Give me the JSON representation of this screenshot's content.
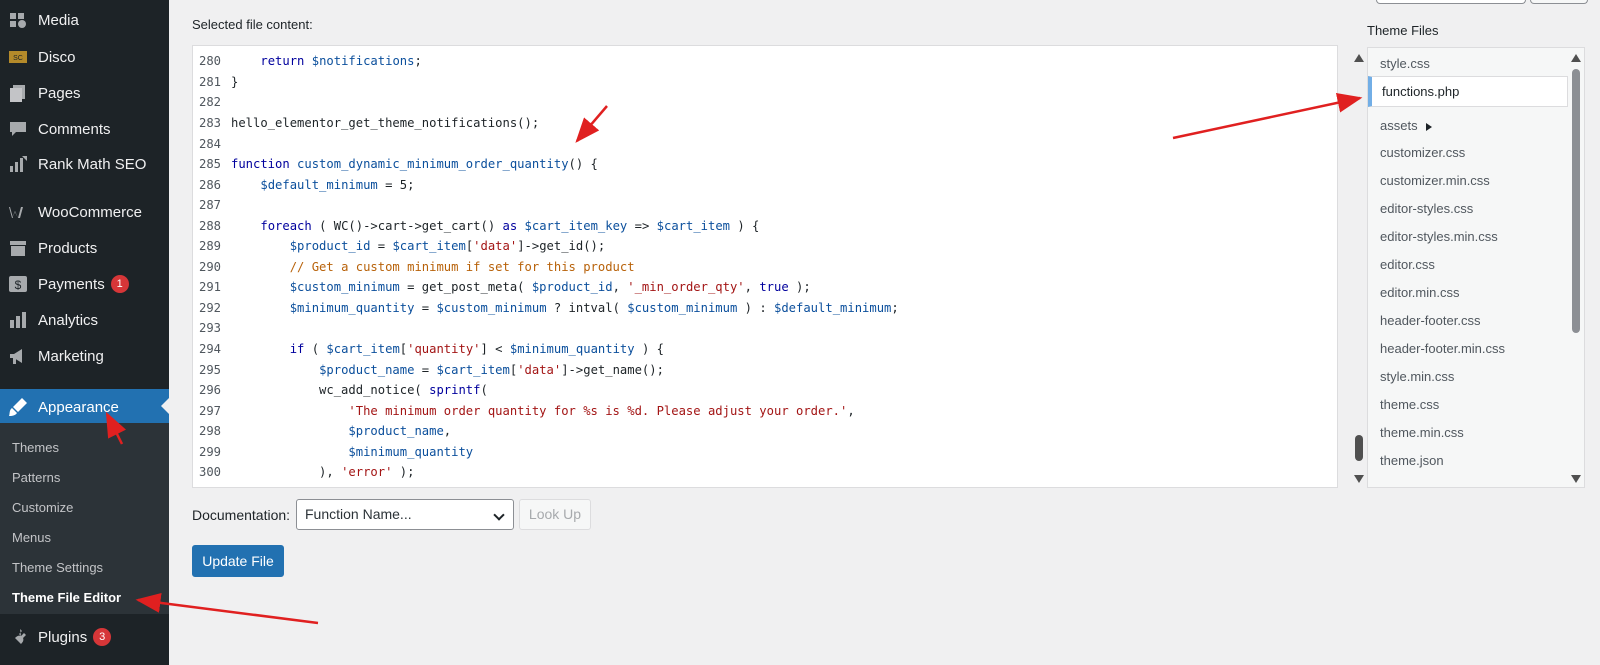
{
  "sidebar": {
    "items": [
      {
        "label": "Media",
        "icon": "media-icon"
      },
      {
        "label": "Disco",
        "icon": "disco-icon"
      },
      {
        "label": "Pages",
        "icon": "pages-icon"
      },
      {
        "label": "Comments",
        "icon": "comments-icon"
      },
      {
        "label": "Rank Math SEO",
        "icon": "rank-math-icon"
      },
      {
        "label": "WooCommerce",
        "icon": "woocommerce-icon"
      },
      {
        "label": "Products",
        "icon": "products-icon"
      },
      {
        "label": "Payments",
        "icon": "payments-icon",
        "badge": "1"
      },
      {
        "label": "Analytics",
        "icon": "analytics-icon"
      },
      {
        "label": "Marketing",
        "icon": "marketing-icon"
      },
      {
        "label": "Appearance",
        "icon": "appearance-icon"
      },
      {
        "label": "Plugins",
        "icon": "plugins-icon",
        "badge": "3"
      }
    ],
    "submenu": [
      "Themes",
      "Patterns",
      "Customize",
      "Menus",
      "Theme Settings",
      "Theme File Editor"
    ]
  },
  "main": {
    "selected_label": "Selected file content:"
  },
  "code_lines": [
    {
      "n": "280",
      "text": "    return $notifications;"
    },
    {
      "n": "281",
      "text": "}"
    },
    {
      "n": "282",
      "text": ""
    },
    {
      "n": "283",
      "text": "hello_elementor_get_theme_notifications();"
    },
    {
      "n": "284",
      "text": ""
    },
    {
      "n": "285",
      "text": "function custom_dynamic_minimum_order_quantity() {"
    },
    {
      "n": "286",
      "text": "    $default_minimum = 5;"
    },
    {
      "n": "287",
      "text": ""
    },
    {
      "n": "288",
      "text": "    foreach ( WC()->cart->get_cart() as $cart_item_key => $cart_item ) {"
    },
    {
      "n": "289",
      "text": "        $product_id = $cart_item['data']->get_id();"
    },
    {
      "n": "290",
      "text": "        // Get a custom minimum if set for this product"
    },
    {
      "n": "291",
      "text": "        $custom_minimum = get_post_meta( $product_id, '_min_order_qty', true );"
    },
    {
      "n": "292",
      "text": "        $minimum_quantity = $custom_minimum ? intval( $custom_minimum ) : $default_minimum;"
    },
    {
      "n": "293",
      "text": ""
    },
    {
      "n": "294",
      "text": "        if ( $cart_item['quantity'] < $minimum_quantity ) {"
    },
    {
      "n": "295",
      "text": "            $product_name = $cart_item['data']->get_name();"
    },
    {
      "n": "296",
      "text": "            wc_add_notice( sprintf("
    },
    {
      "n": "297",
      "text": "                'The minimum order quantity for %s is %d. Please adjust your order.',"
    },
    {
      "n": "298",
      "text": "                $product_name,"
    },
    {
      "n": "299",
      "text": "                $minimum_quantity"
    },
    {
      "n": "300",
      "text": "            ), 'error' );"
    }
  ],
  "theme_files": {
    "title": "Theme Files",
    "items": [
      "style.css",
      "functions.php",
      "assets",
      "customizer.css",
      "customizer.min.css",
      "editor-styles.css",
      "editor-styles.min.css",
      "editor.css",
      "editor.min.css",
      "header-footer.css",
      "header-footer.min.css",
      "style.min.css",
      "theme.css",
      "theme.min.css",
      "theme.json"
    ]
  },
  "documentation": {
    "label": "Documentation:",
    "select_value": "Function Name...",
    "lookup_label": "Look Up"
  },
  "update_label": "Update File",
  "colors": {
    "sidebar_bg": "#1d2327",
    "accent": "#2271b1",
    "badge": "#d63638",
    "annotation_arrow": "#e02020"
  }
}
